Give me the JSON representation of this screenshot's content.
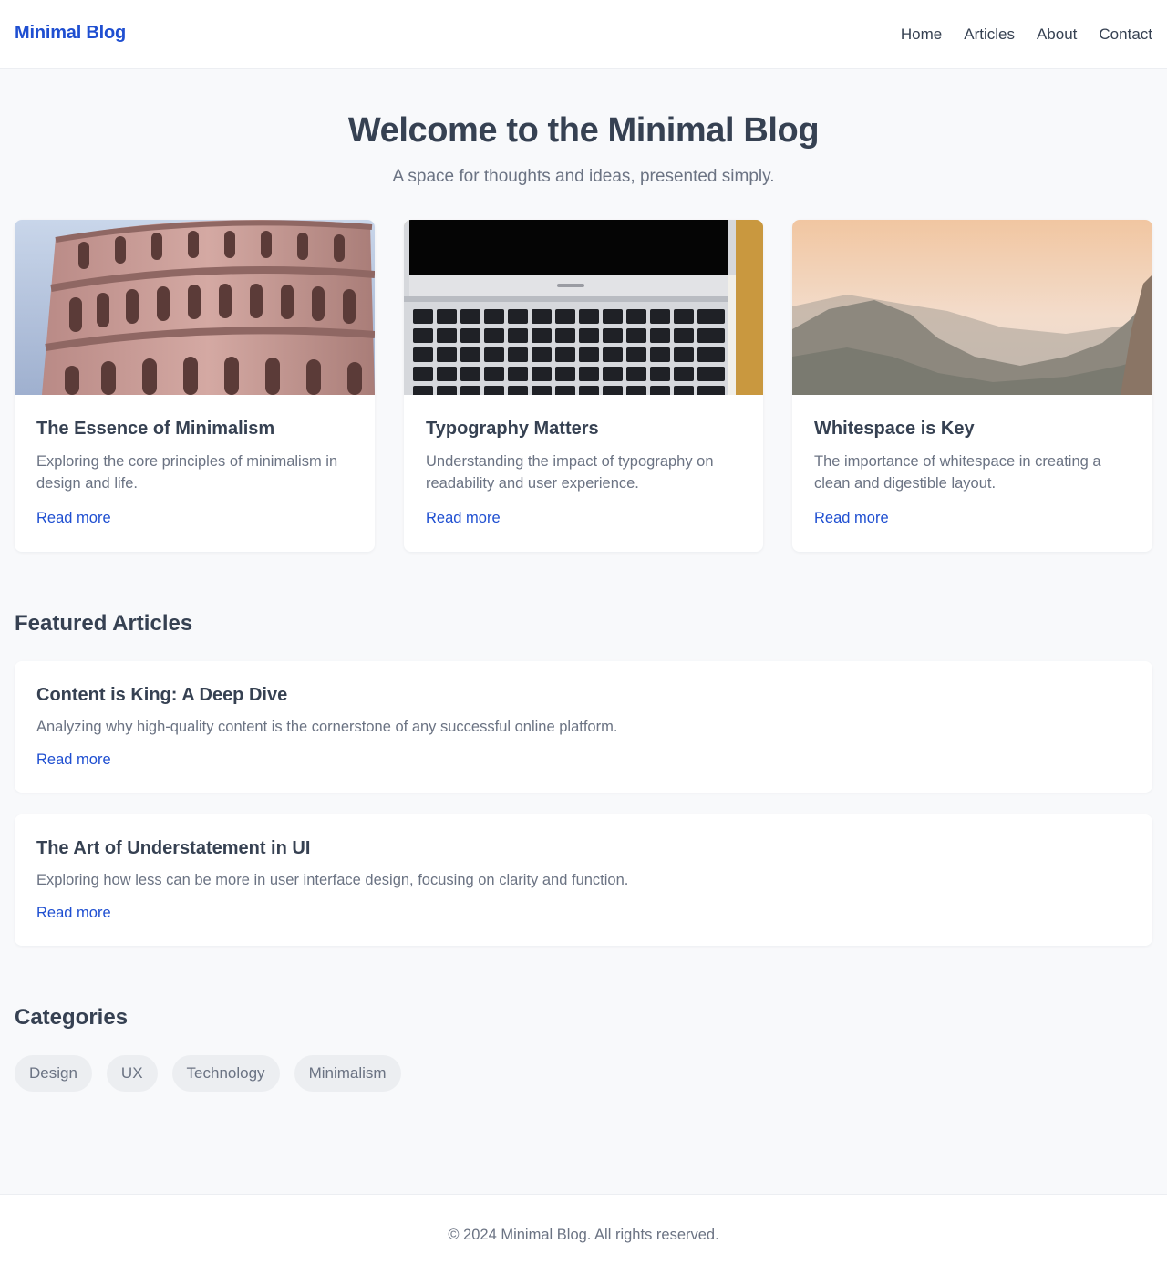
{
  "header": {
    "brand": "Minimal Blog",
    "nav": [
      "Home",
      "Articles",
      "About",
      "Contact"
    ]
  },
  "hero": {
    "title": "Welcome to the Minimal Blog",
    "subtitle": "A space for thoughts and ideas, presented simply."
  },
  "cards": [
    {
      "title": "The Essence of Minimalism",
      "excerpt": "Exploring the core principles of minimalism in design and life.",
      "link": "Read more",
      "image": "leaning-tower-photo"
    },
    {
      "title": "Typography Matters",
      "excerpt": "Understanding the impact of typography on readability and user experience.",
      "link": "Read more",
      "image": "laptop-keyboard-photo"
    },
    {
      "title": "Whitespace is Key",
      "excerpt": "The importance of whitespace in creating a clean and digestible layout.",
      "link": "Read more",
      "image": "misty-mountains-photo"
    }
  ],
  "featured": {
    "heading": "Featured Articles",
    "items": [
      {
        "title": "Content is King: A Deep Dive",
        "excerpt": "Analyzing why high-quality content is the cornerstone of any successful online platform.",
        "link": "Read more"
      },
      {
        "title": "The Art of Understatement in UI",
        "excerpt": "Exploring how less can be more in user interface design, focusing on clarity and function.",
        "link": "Read more"
      }
    ]
  },
  "categories": {
    "heading": "Categories",
    "items": [
      "Design",
      "UX",
      "Technology",
      "Minimalism"
    ]
  },
  "footer": {
    "text": "© 2024 Minimal Blog. All rights reserved."
  },
  "colors": {
    "accent": "#1f4fd1",
    "text": "#364152",
    "muted": "#6b7383",
    "background": "#f8f9fb"
  }
}
